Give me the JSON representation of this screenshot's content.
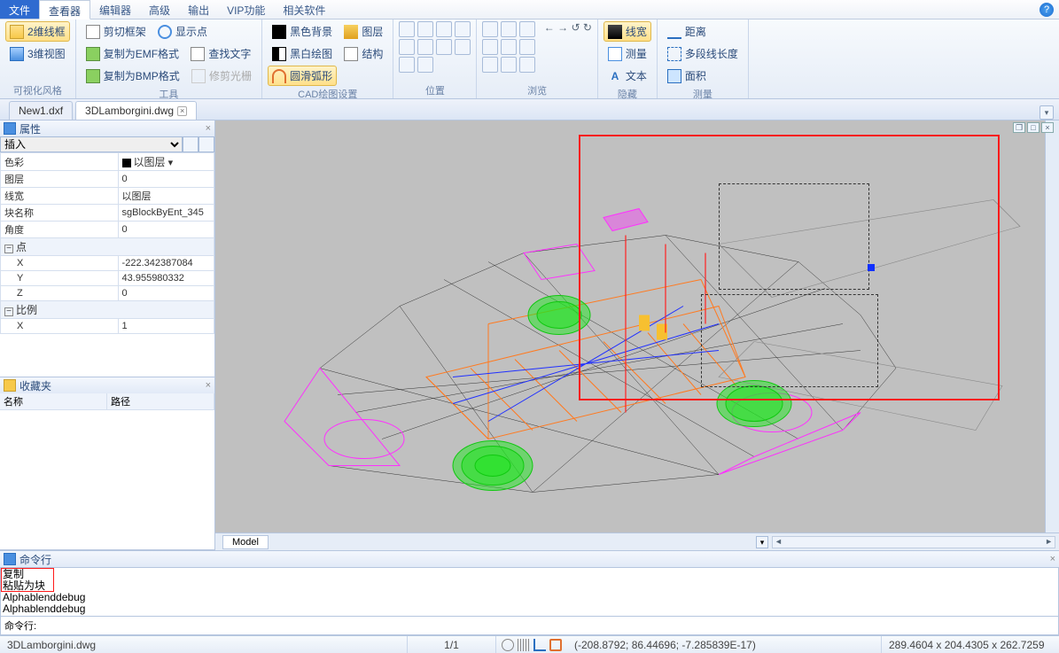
{
  "menu": {
    "file": "文件",
    "viewer": "查看器",
    "editor": "编辑器",
    "advanced": "高级",
    "output": "输出",
    "vip": "VIP功能",
    "related": "相关软件"
  },
  "ribbon": {
    "g1": {
      "btn1": "2维线框",
      "btn2": "3维视图",
      "title": "可视化风格"
    },
    "g2": {
      "b1": "剪切框架",
      "b2": "复制为EMF格式",
      "b3": "复制为BMP格式",
      "b4": "显示点",
      "b5": "查找文字",
      "b6": "修剪光栅",
      "title": "工具"
    },
    "g3": {
      "b1": "黑色背景",
      "b2": "黑白绘图",
      "b3": "圆滑弧形",
      "b4": "图层",
      "b5": "结构",
      "title": "CAD绘图设置"
    },
    "g4": {
      "title": "位置"
    },
    "g5": {
      "title": "浏览"
    },
    "g6": {
      "b1": "线宽",
      "b2": "测量",
      "b3": "文本",
      "title": "隐藏"
    },
    "g7": {
      "b1": "距离",
      "b2": "多段线长度",
      "b3": "面积",
      "title": "测量"
    }
  },
  "tabs": {
    "t1": "New1.dxf",
    "t2": "3DLamborgini.dwg"
  },
  "props": {
    "title": "属性",
    "selector": "插入",
    "rows": {
      "color_k": "色彩",
      "color_v": "以图层",
      "layer_k": "图层",
      "layer_v": "0",
      "lw_k": "线宽",
      "lw_v": "以图层",
      "bn_k": "块名称",
      "bn_v": "sgBlockByEnt_345",
      "ang_k": "角度",
      "ang_v": "0",
      "pt": "点",
      "x": "X",
      "y": "Y",
      "z": "Z",
      "xv": "-222.342387084",
      "yv": "43.955980332",
      "zv": "0",
      "scale": "比例",
      "sx": "X",
      "sxv": "1"
    }
  },
  "fav": {
    "title": "收藏夹",
    "c1": "名称",
    "c2": "路径"
  },
  "model": {
    "tab": "Model"
  },
  "cmd": {
    "title": "命令行",
    "l1": "复制",
    "l2": "粘贴为块",
    "l3": "Alphablenddebug",
    "l4": "Alphablenddebug",
    "label": "命令行:"
  },
  "status": {
    "file": "3DLamborgini.dwg",
    "page": "1/1",
    "coords": "(-208.8792; 86.44696; -7.285839E-17)",
    "dims": "289.4604 x 204.4305 x 262.7259"
  }
}
